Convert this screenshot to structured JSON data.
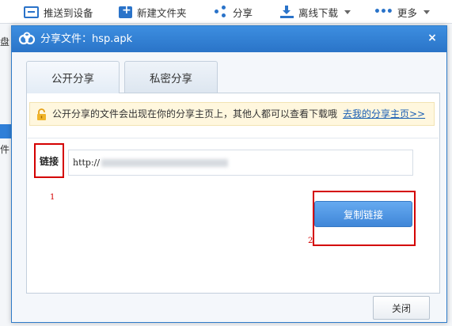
{
  "toolbar": {
    "items": [
      {
        "label": "推送到设备",
        "icon": "send-to-device-icon"
      },
      {
        "label": "新建文件夹",
        "icon": "new-folder-icon"
      },
      {
        "label": "分享",
        "icon": "share-icon"
      },
      {
        "label": "离线下载",
        "icon": "offline-download-icon"
      },
      {
        "label": "更多",
        "icon": "more-dots-icon"
      }
    ]
  },
  "background": {
    "left_text_1": "盘",
    "left_text_2": "件工"
  },
  "dialog": {
    "title": "分享文件：hsp.apk",
    "close_glyph": "×",
    "tabs": [
      {
        "label": "公开分享",
        "active": true
      },
      {
        "label": "私密分享",
        "active": false
      }
    ],
    "notice": {
      "text": "公开分享的文件会出现在你的分享主页上，其他人都可以查看下载哦",
      "link": "去我的分享主页>>"
    },
    "link_label": "链接",
    "url_prefix": "http://",
    "copy_button": "复制链接",
    "annotation_1": "1",
    "annotation_2": "2",
    "close_button": "关闭"
  },
  "colors": {
    "accent": "#2a74c8",
    "annotation_red": "#d40000",
    "notice_bg": "#fff7de"
  }
}
